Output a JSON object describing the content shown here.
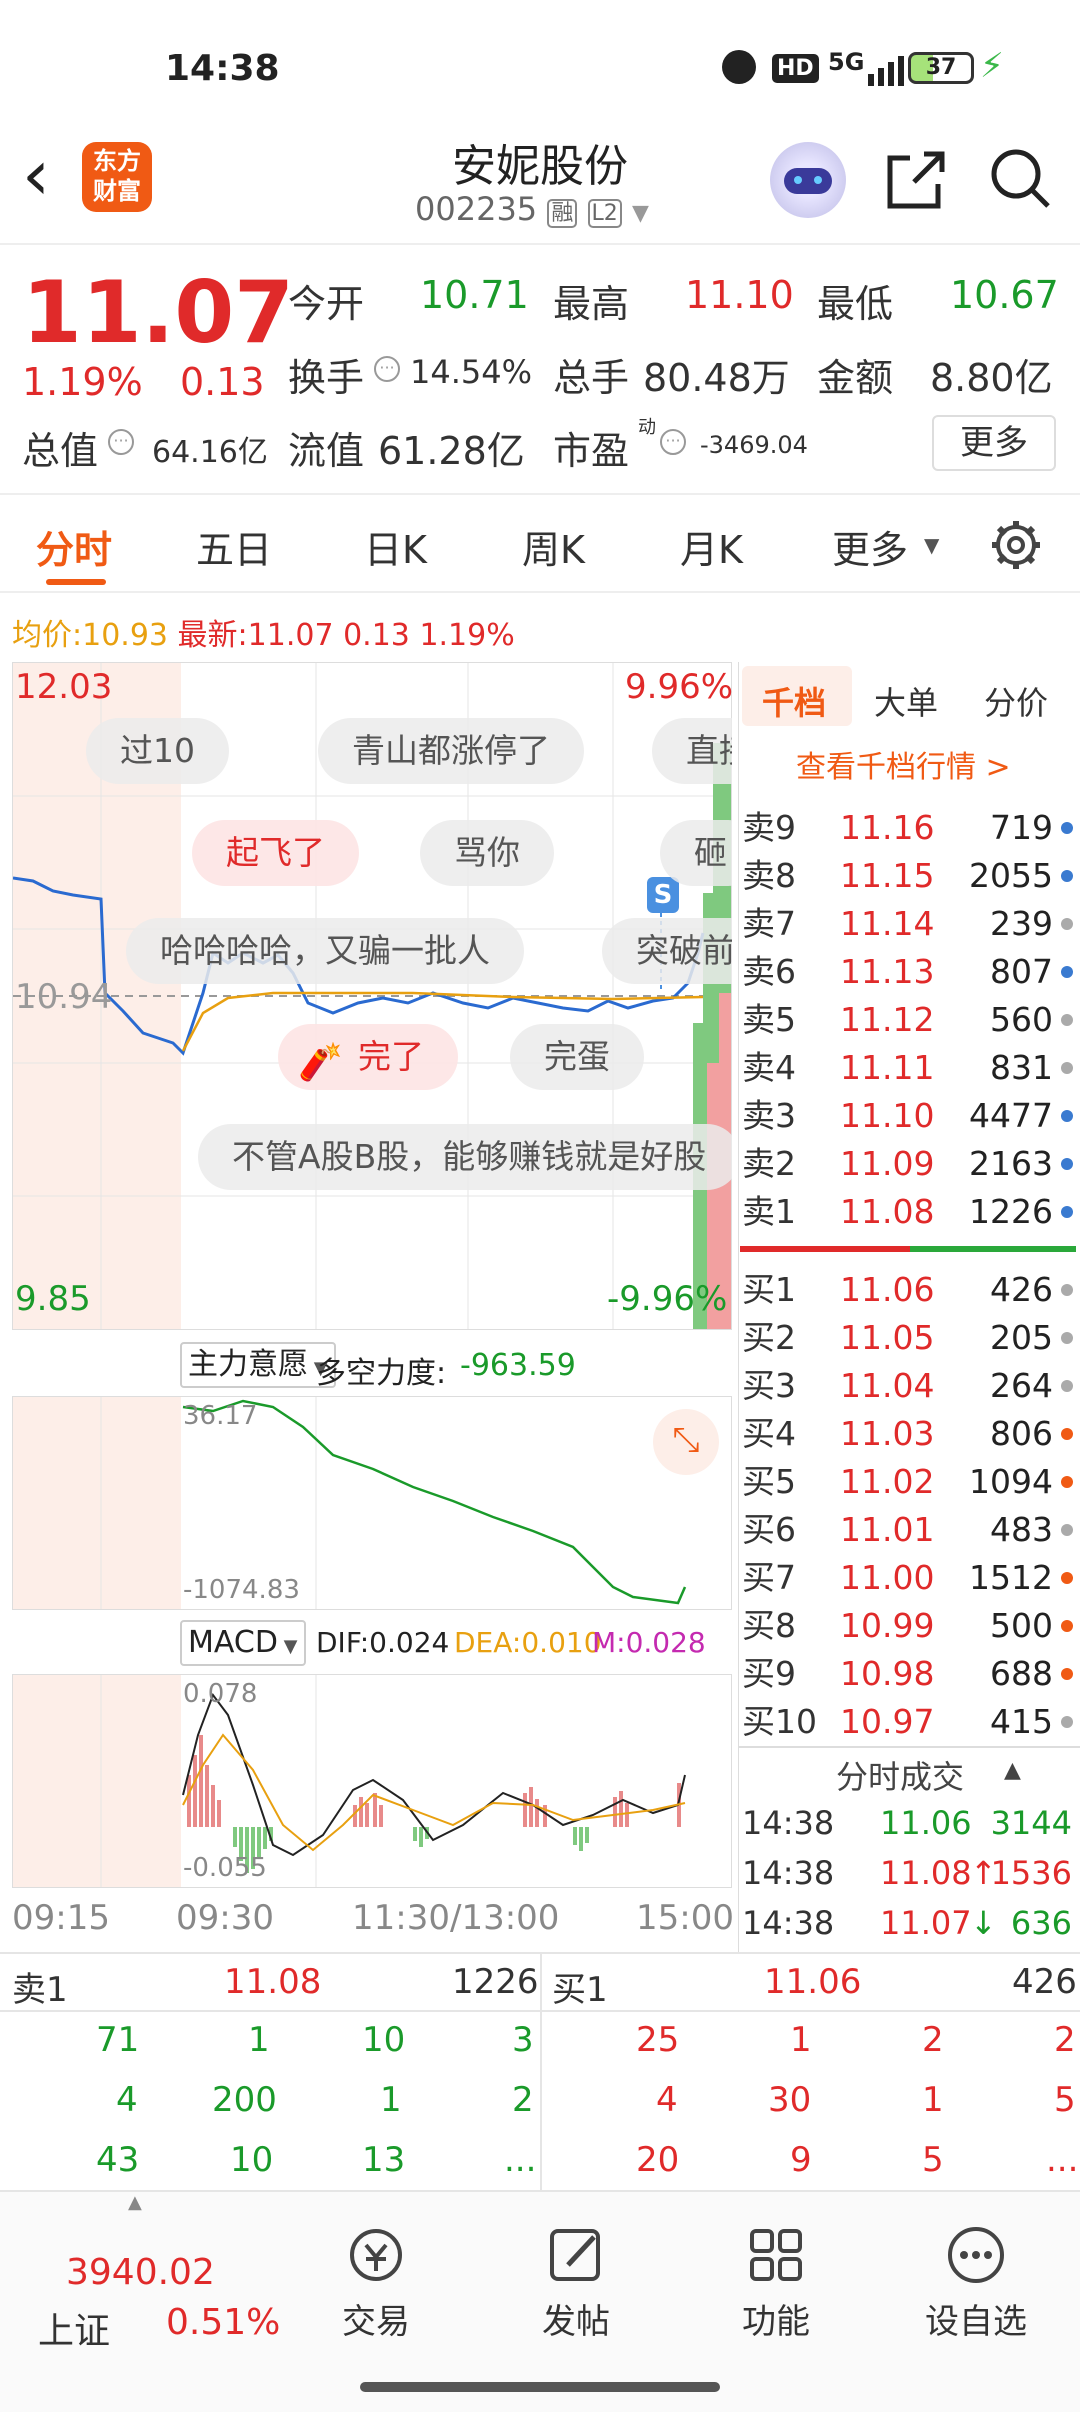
{
  "status": {
    "time": "14:38",
    "battery": "37",
    "net": "5G"
  },
  "header": {
    "back": "‹",
    "logo_line1": "东方",
    "logo_line2": "财富",
    "title": "安妮股份",
    "code": "002235",
    "tag1": "融",
    "tag2": "L2"
  },
  "quote": {
    "price": "11.07",
    "pct": "1.19%",
    "chg": "0.13",
    "open_label": "今开",
    "open": "10.71",
    "high_label": "最高",
    "high": "11.10",
    "low_label": "最低",
    "low": "10.67",
    "turnover_label": "换手",
    "turnover": "14.54%",
    "volume_label": "总手",
    "volume": "80.48万",
    "amount_label": "金额",
    "amount": "8.80亿",
    "mcap_label": "总值",
    "mcap": "64.16亿",
    "float_label": "流值",
    "float": "61.28亿",
    "pe_label": "市盈",
    "pe_sup": "动",
    "pe": "-3469.04",
    "more": "更多"
  },
  "tabs": [
    "分时",
    "五日",
    "日K",
    "周K",
    "月K",
    "更多"
  ],
  "avg": {
    "label": "均价:",
    "value": "10.93",
    "latest_label": "最新:",
    "latest": "11.07",
    "chg": "0.13",
    "pct": "1.19%"
  },
  "chart": {
    "ymax": "12.03",
    "ymin": "9.85",
    "pmax": "9.96%",
    "pmin": "-9.96%",
    "ref": "10.94",
    "times": [
      "09:15",
      "09:30",
      "11:30/13:00",
      "15:00"
    ]
  },
  "danmu": [
    "过10",
    "青山都涨停了",
    "直接",
    "起飞了",
    "骂你",
    "砸",
    "哈哈哈哈，又骗一批人",
    "突破前",
    "完了",
    "完蛋",
    "不管A股B股，能够赚钱就是好股"
  ],
  "mid": {
    "indicator": "主力意愿",
    "dk_label": "多空力度:",
    "dk": "-963.59",
    "top": "36.17",
    "bottom": "-1074.83"
  },
  "macd": {
    "label": "MACD",
    "dif": "DIF:0.024",
    "dea": "DEA:0.010",
    "m": "M:0.028",
    "top": "0.078",
    "bottom": "-0.055"
  },
  "orderbook": {
    "tabs": [
      "千档",
      "大单",
      "分价"
    ],
    "link": "查看千档行情 >",
    "sell": [
      {
        "l": "卖9",
        "p": "11.16",
        "v": "719"
      },
      {
        "l": "卖8",
        "p": "11.15",
        "v": "2055"
      },
      {
        "l": "卖7",
        "p": "11.14",
        "v": "239"
      },
      {
        "l": "卖6",
        "p": "11.13",
        "v": "807"
      },
      {
        "l": "卖5",
        "p": "11.12",
        "v": "560"
      },
      {
        "l": "卖4",
        "p": "11.11",
        "v": "831"
      },
      {
        "l": "卖3",
        "p": "11.10",
        "v": "4477"
      },
      {
        "l": "卖2",
        "p": "11.09",
        "v": "2163"
      },
      {
        "l": "卖1",
        "p": "11.08",
        "v": "1226"
      }
    ],
    "buy": [
      {
        "l": "买1",
        "p": "11.06",
        "v": "426"
      },
      {
        "l": "买2",
        "p": "11.05",
        "v": "205"
      },
      {
        "l": "买3",
        "p": "11.04",
        "v": "264"
      },
      {
        "l": "买4",
        "p": "11.03",
        "v": "806"
      },
      {
        "l": "买5",
        "p": "11.02",
        "v": "1094"
      },
      {
        "l": "买6",
        "p": "11.01",
        "v": "483"
      },
      {
        "l": "买7",
        "p": "11.00",
        "v": "1512"
      },
      {
        "l": "买8",
        "p": "10.99",
        "v": "500"
      },
      {
        "l": "买9",
        "p": "10.98",
        "v": "688"
      },
      {
        "l": "买10",
        "p": "10.97",
        "v": "415"
      }
    ],
    "trades_title": "分时成交",
    "trades": [
      {
        "t": "14:38",
        "p": "11.06",
        "v": "3144",
        "arrow": ""
      },
      {
        "t": "14:38",
        "p": "11.08",
        "v": "1536",
        "arrow": "↑"
      },
      {
        "t": "14:38",
        "p": "11.07",
        "v": "636",
        "arrow": "↓"
      }
    ]
  },
  "queue": {
    "sell_label": "卖1",
    "sell_price": "11.08",
    "sell_vol": "1226",
    "buy_label": "买1",
    "buy_price": "11.06",
    "buy_vol": "426",
    "sell_rows": [
      [
        "71",
        "1",
        "10",
        "3"
      ],
      [
        "4",
        "200",
        "1",
        "2"
      ],
      [
        "43",
        "10",
        "13",
        "..."
      ]
    ],
    "buy_rows": [
      [
        "25",
        "1",
        "2",
        "2"
      ],
      [
        "4",
        "30",
        "1",
        "5"
      ],
      [
        "20",
        "9",
        "5",
        "..."
      ]
    ]
  },
  "bottom": {
    "index_value": "3940.02",
    "index_name": "上证",
    "index_pct": "0.51%",
    "items": [
      "交易",
      "发帖",
      "功能",
      "设自选"
    ]
  }
}
